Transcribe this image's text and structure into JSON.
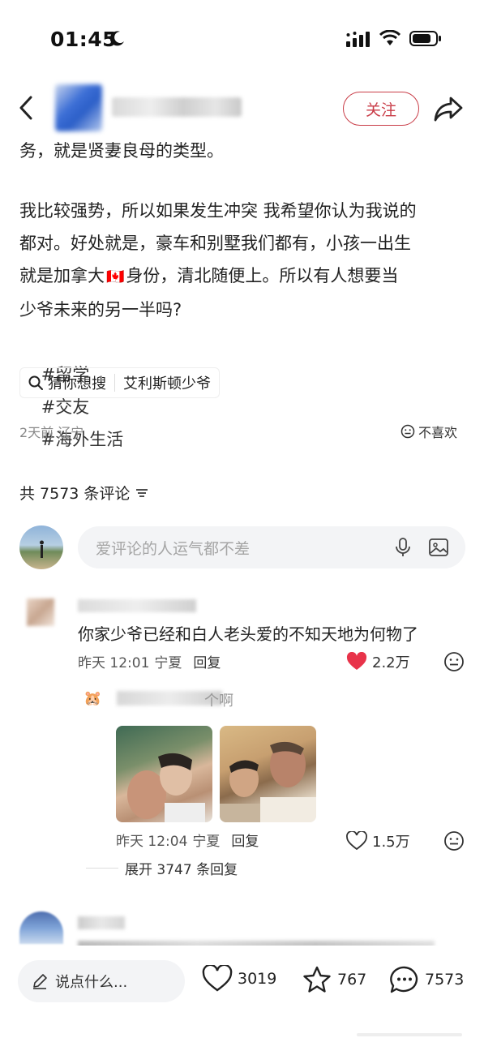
{
  "status_bar": {
    "time": "01:45"
  },
  "header": {
    "follow_label": "关注"
  },
  "post": {
    "line1": "务，就是贤妻良母的类型。",
    "para2_l1": "我比较强势，所以如果发生冲突 我希望你认为我说的",
    "para2_l2": "都对。好处就是，豪车和别墅我们都有，小孩一出生",
    "para2_l3a": "就是加拿大",
    "para2_flag": "🇨🇦",
    "para2_l3b": "身份，清北随便上。所以有人想要当",
    "para2_l4": "少爷未来的另一半吗?",
    "hashtags": [
      "#留学",
      "#交友",
      "#海外生活"
    ]
  },
  "search_chip": {
    "guess_label": "猜你想搜",
    "suggestion": "艾利斯顿少爷"
  },
  "meta": {
    "time_location": "2天前 辽宁",
    "dislike_label": "不喜欢"
  },
  "comments_header": {
    "count_label": "共 7573 条评论"
  },
  "comment_input": {
    "placeholder": "爱评论的人运气都不差"
  },
  "comment1": {
    "text": "你家少爷已经和白人老头爱的不知天地为何物了",
    "time": "昨天 12:01",
    "location": "宁夏",
    "reply_label": "回复",
    "likes": "2.2万"
  },
  "reply1": {
    "text_tail": "个啊",
    "time": "昨天 12:04",
    "location": "宁夏",
    "reply_label": "回复",
    "likes": "1.5万",
    "expand_label": "展开 3747 条回复"
  },
  "bottom_bar": {
    "say_placeholder": "说点什么...",
    "likes": "3019",
    "favorites": "767",
    "comments": "7573"
  },
  "colors": {
    "accent_red": "#c93d48",
    "liked_heart": "#e8334a",
    "hashtag": "#1f3d7a"
  }
}
